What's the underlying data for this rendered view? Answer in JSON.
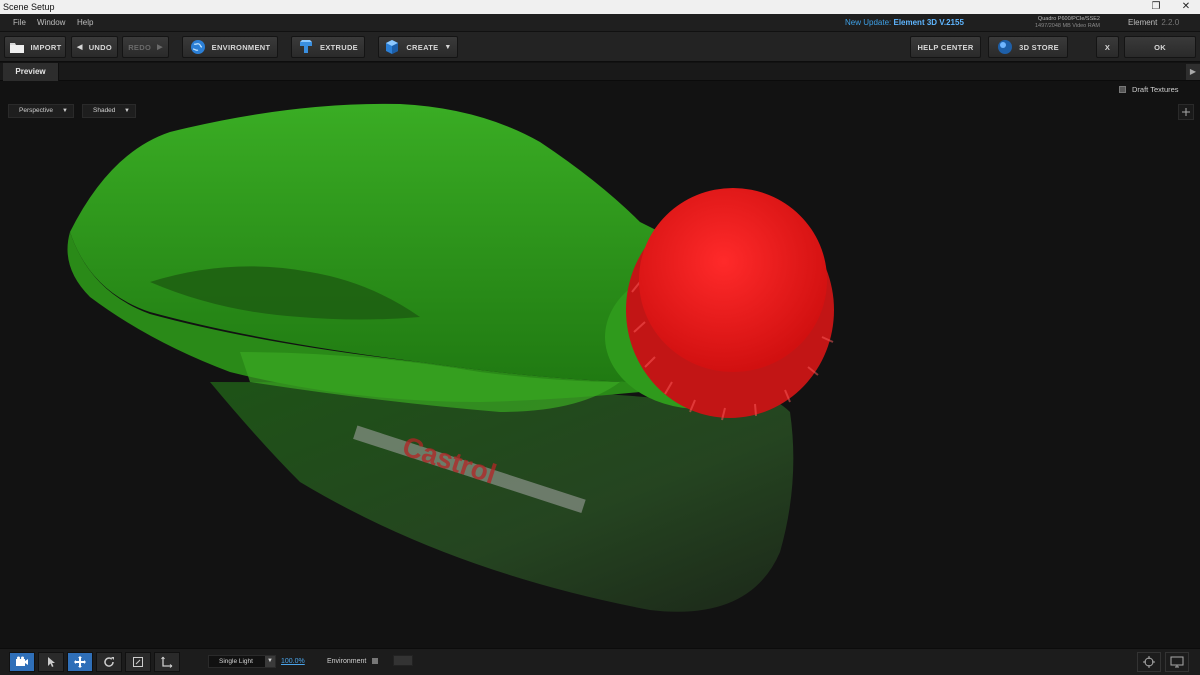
{
  "window": {
    "title": "Scene Setup"
  },
  "menu": {
    "items": [
      "File",
      "Window",
      "Help"
    ],
    "update_prefix": "New Update:",
    "update_version": "Element 3D V.2155",
    "gpu_line1": "Quadro P600/PCIe/SSE2",
    "gpu_line2": "1497/2048 MB Video RAM",
    "app_name": "Element",
    "app_version": "2.2.0"
  },
  "toolbar": {
    "import": "IMPORT",
    "undo": "UNDO",
    "redo": "REDO",
    "environment": "ENVIRONMENT",
    "extrude": "EXTRUDE",
    "create": "CREATE",
    "help_center": "HELP CENTER",
    "store": "3D STORE",
    "close": "X",
    "ok": "OK"
  },
  "tabs": {
    "preview": "Preview"
  },
  "viewport": {
    "view_mode": "Perspective",
    "shading_mode": "Shaded",
    "draft_textures": "Draft Textures",
    "label_text": "Castrol"
  },
  "bottom": {
    "light_mode": "Single Light",
    "light_intensity": "100.0%",
    "environment_label": "Environment"
  },
  "colors": {
    "body_green": "#2f9a1c",
    "cap_red": "#e01414",
    "accent_blue": "#2f6fb8"
  }
}
